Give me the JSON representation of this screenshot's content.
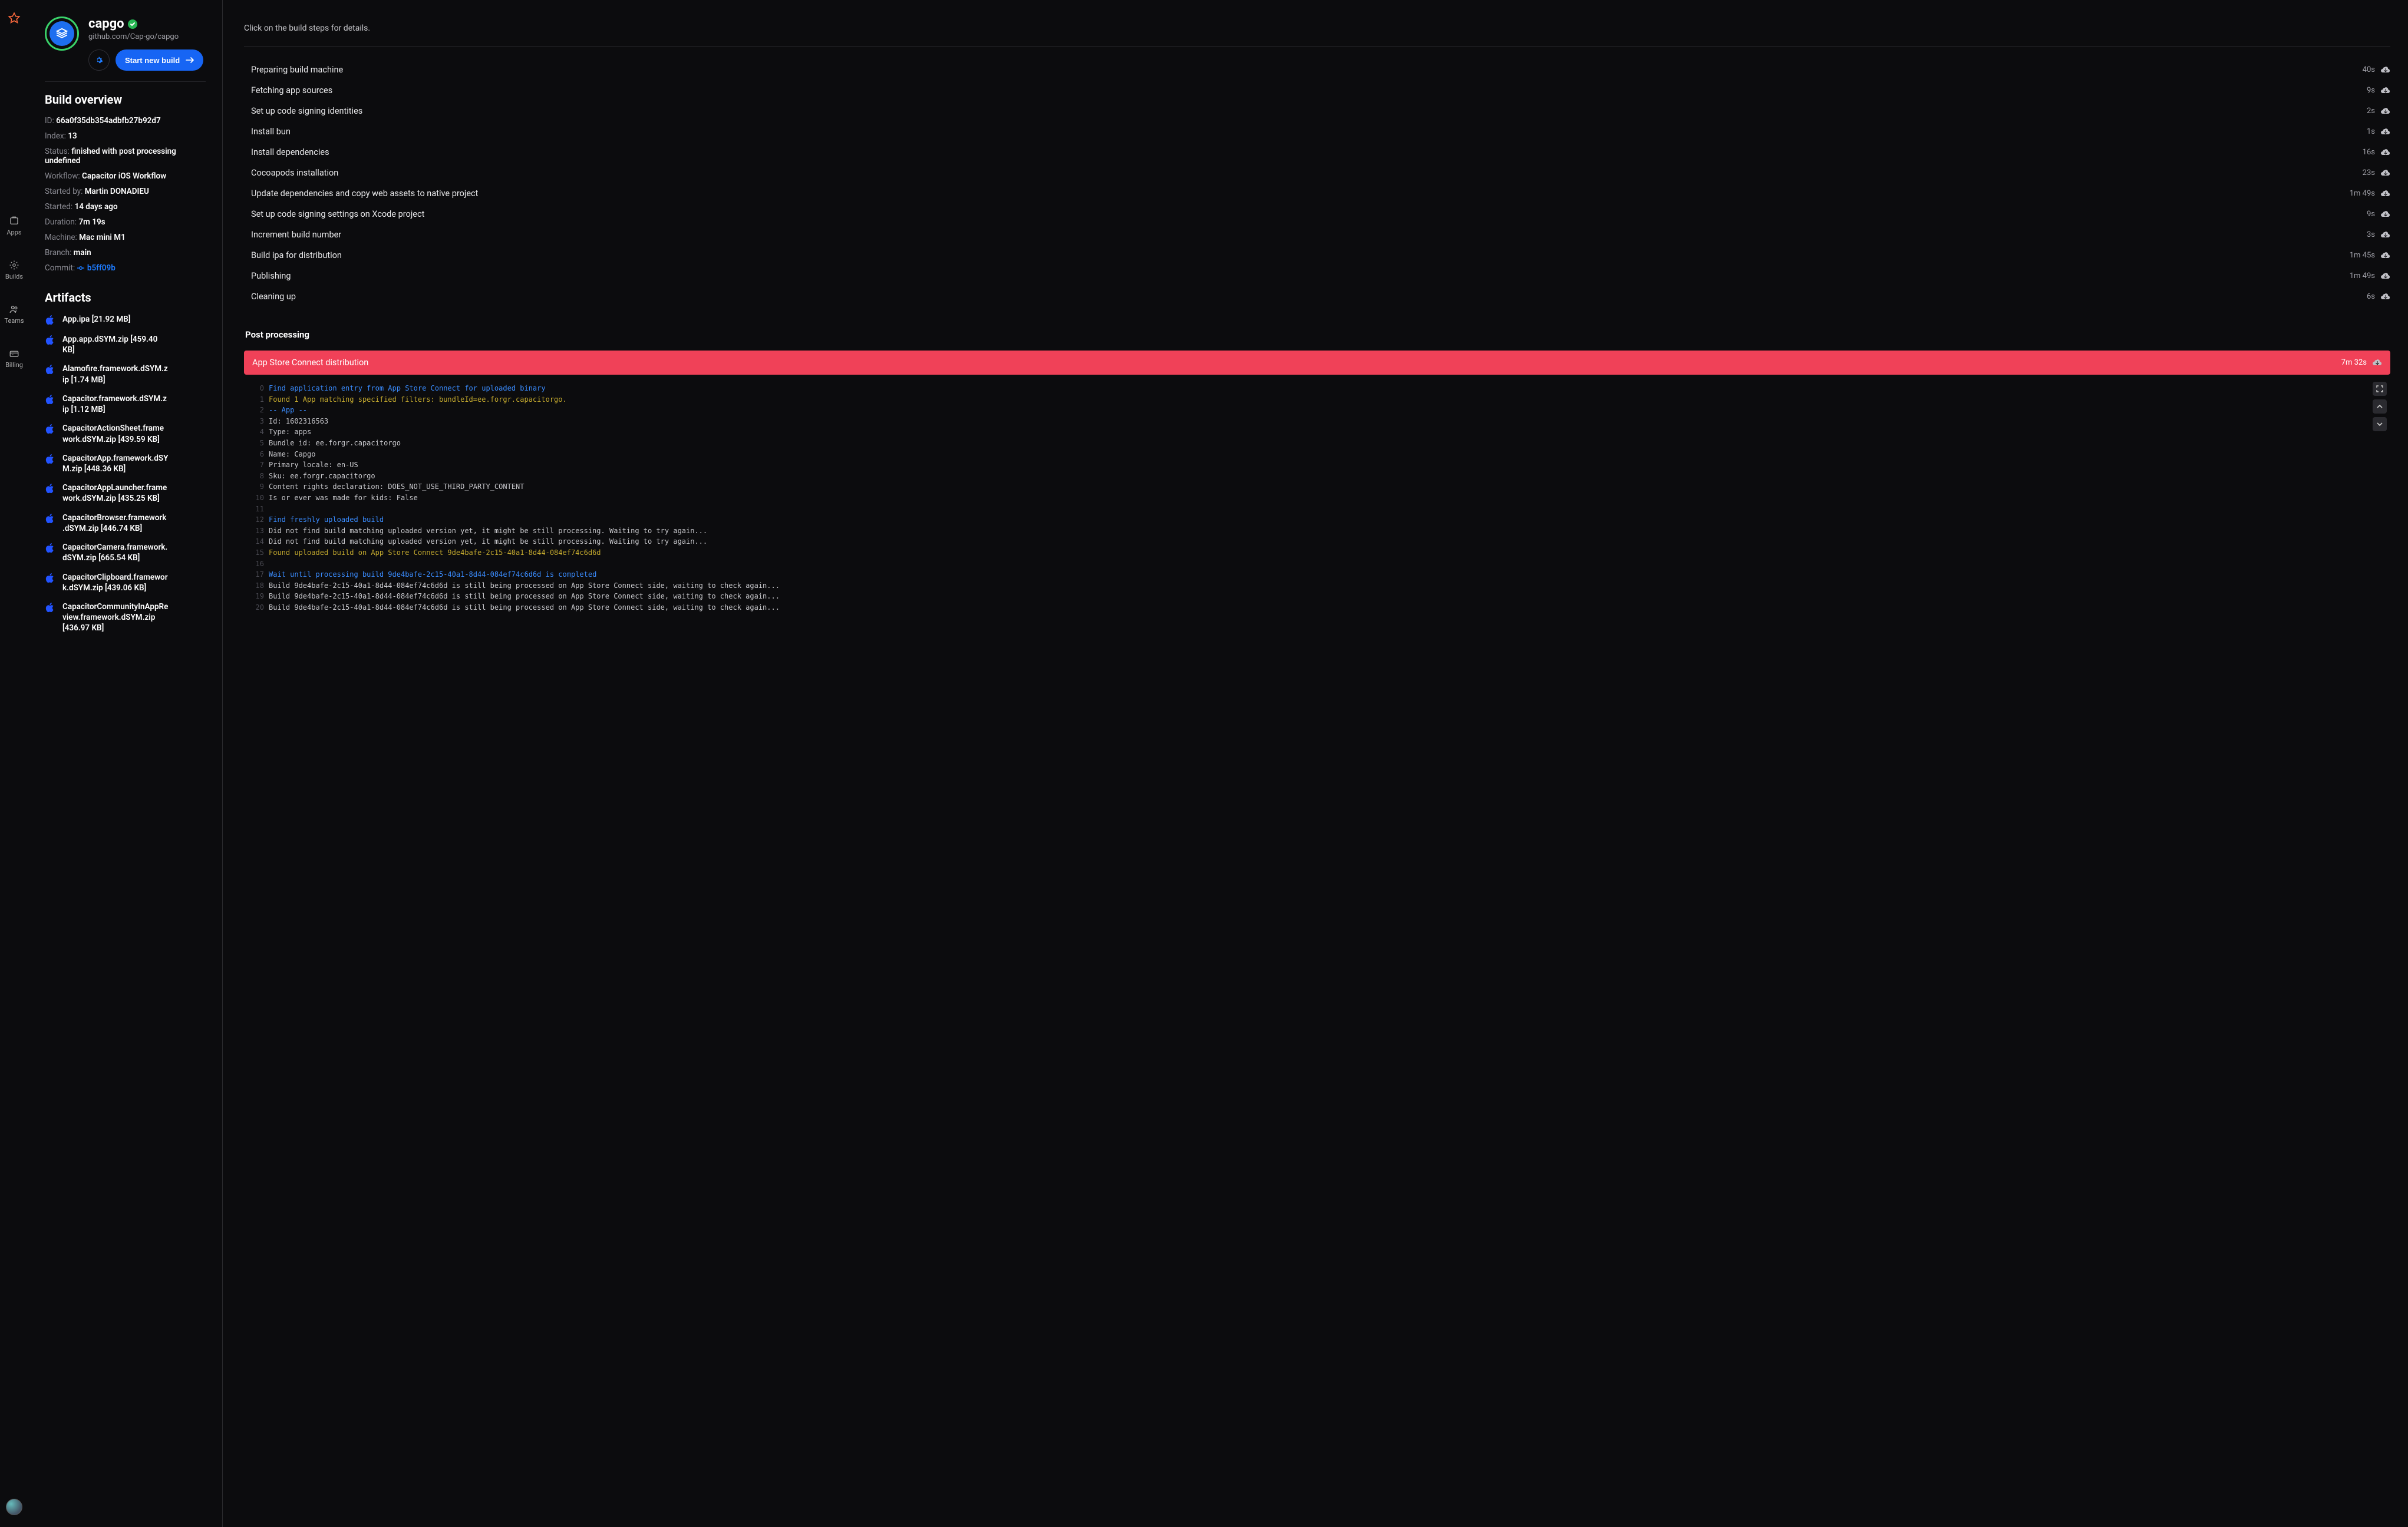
{
  "nav": {
    "items": [
      "Apps",
      "Builds",
      "Teams",
      "Billing"
    ]
  },
  "project": {
    "title": "capgo",
    "subtitle": "github.com/Cap-go/capgo",
    "start_build": "Start new build"
  },
  "overview": {
    "title": "Build overview",
    "rows": [
      {
        "k": "ID:",
        "v": "66a0f35db354adbfb27b92d7"
      },
      {
        "k": "Index:",
        "v": "13"
      },
      {
        "k": "Status:",
        "v": "finished with post processing undefined"
      },
      {
        "k": "Workflow:",
        "v": "Capacitor iOS Workflow"
      },
      {
        "k": "Started by:",
        "v": "Martin DONADIEU"
      },
      {
        "k": "Started:",
        "v": "14 days ago"
      },
      {
        "k": "Duration:",
        "v": "7m 19s"
      },
      {
        "k": "Machine:",
        "v": "Mac mini M1"
      },
      {
        "k": "Branch:",
        "v": "main"
      }
    ],
    "commit": {
      "k": "Commit:",
      "v": "b5ff09b"
    }
  },
  "artifacts": {
    "title": "Artifacts",
    "items": [
      "App.ipa [21.92 MB]",
      "App.app.dSYM.zip [459.40 KB]",
      "Alamofire.framework.dSYM.zip [1.74 MB]",
      "Capacitor.framework.dSYM.zip [1.12 MB]",
      "CapacitorActionSheet.framework.dSYM.zip [439.59 KB]",
      "CapacitorApp.framework.dSYM.zip [448.36 KB]",
      "CapacitorAppLauncher.framework.dSYM.zip [435.25 KB]",
      "CapacitorBrowser.framework.dSYM.zip [446.74 KB]",
      "CapacitorCamera.framework.dSYM.zip [665.54 KB]",
      "CapacitorClipboard.framework.dSYM.zip [439.06 KB]",
      "CapacitorCommunityInAppReview.framework.dSYM.zip [436.97 KB]"
    ]
  },
  "steps": {
    "hint": "Click on the build steps for details.",
    "items": [
      {
        "name": "Preparing build machine",
        "time": "40s"
      },
      {
        "name": "Fetching app sources",
        "time": "9s"
      },
      {
        "name": "Set up code signing identities",
        "time": "2s"
      },
      {
        "name": "Install bun",
        "time": "1s"
      },
      {
        "name": "Install dependencies",
        "time": "16s"
      },
      {
        "name": "Cocoapods installation",
        "time": "23s"
      },
      {
        "name": "Update dependencies and copy web assets to native project",
        "time": "1m 49s"
      },
      {
        "name": "Set up code signing settings on Xcode project",
        "time": "9s"
      },
      {
        "name": "Increment build number",
        "time": "3s"
      },
      {
        "name": "Build ipa for distribution",
        "time": "1m 45s"
      },
      {
        "name": "Publishing",
        "time": "1m 49s"
      },
      {
        "name": "Cleaning up",
        "time": "6s"
      }
    ]
  },
  "post": {
    "title": "Post processing",
    "error": {
      "name": "App Store Connect distribution",
      "time": "7m 32s"
    },
    "log": [
      {
        "n": 0,
        "c": "blue",
        "t": "Find application entry from App Store Connect for uploaded binary"
      },
      {
        "n": 1,
        "c": "yellow",
        "t": "Found 1 App matching specified filters: bundleId=ee.forgr.capacitorgo."
      },
      {
        "n": 2,
        "c": "blue",
        "t": "-- App --"
      },
      {
        "n": 3,
        "c": "default",
        "t": "Id: 1602316563"
      },
      {
        "n": 4,
        "c": "default",
        "t": "Type: apps"
      },
      {
        "n": 5,
        "c": "default",
        "t": "Bundle id: ee.forgr.capacitorgo"
      },
      {
        "n": 6,
        "c": "default",
        "t": "Name: Capgo"
      },
      {
        "n": 7,
        "c": "default",
        "t": "Primary locale: en-US"
      },
      {
        "n": 8,
        "c": "default",
        "t": "Sku: ee.forgr.capacitorgo"
      },
      {
        "n": 9,
        "c": "default",
        "t": "Content rights declaration: DOES_NOT_USE_THIRD_PARTY_CONTENT"
      },
      {
        "n": 10,
        "c": "default",
        "t": "Is or ever was made for kids: False"
      },
      {
        "n": 11,
        "c": "default",
        "t": ""
      },
      {
        "n": 12,
        "c": "blue",
        "t": "Find freshly uploaded build"
      },
      {
        "n": 13,
        "c": "default",
        "t": "Did not find build matching uploaded version yet, it might be still processing. Waiting to try again..."
      },
      {
        "n": 14,
        "c": "default",
        "t": "Did not find build matching uploaded version yet, it might be still processing. Waiting to try again..."
      },
      {
        "n": 15,
        "c": "yellow",
        "t": "Found uploaded build on App Store Connect 9de4bafe-2c15-40a1-8d44-084ef74c6d6d"
      },
      {
        "n": 16,
        "c": "default",
        "t": ""
      },
      {
        "n": 17,
        "c": "blue",
        "t": "Wait until processing build 9de4bafe-2c15-40a1-8d44-084ef74c6d6d is completed"
      },
      {
        "n": 18,
        "c": "default",
        "t": "Build 9de4bafe-2c15-40a1-8d44-084ef74c6d6d is still being processed on App Store Connect side, waiting to check again..."
      },
      {
        "n": 19,
        "c": "default",
        "t": "Build 9de4bafe-2c15-40a1-8d44-084ef74c6d6d is still being processed on App Store Connect side, waiting to check again..."
      },
      {
        "n": 20,
        "c": "default",
        "t": "Build 9de4bafe-2c15-40a1-8d44-084ef74c6d6d is still being processed on App Store Connect side, waiting to check again..."
      }
    ]
  }
}
